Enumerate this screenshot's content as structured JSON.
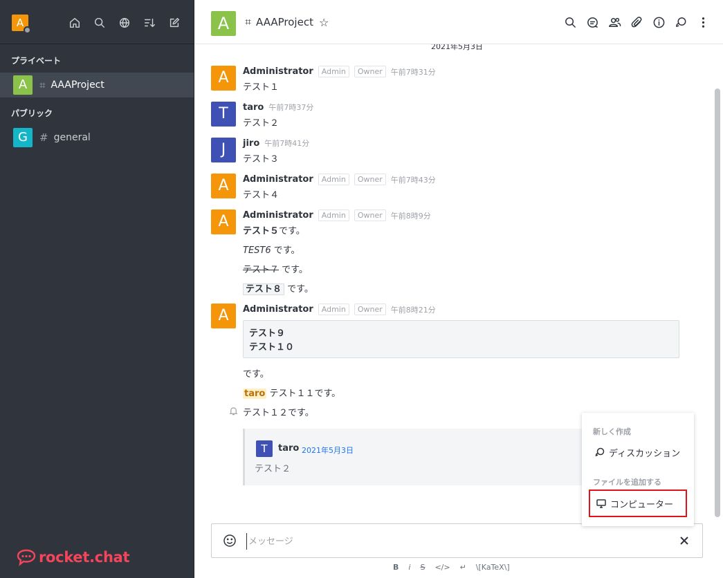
{
  "colors": {
    "sidebar_bg": "#2f343d",
    "accent_orange": "#f5960a",
    "avatar_green": "#8bc34a",
    "avatar_indigo": "#3f51b5",
    "avatar_teal": "#13b5c7",
    "brand_red": "#f5455c",
    "highlight_red": "#e0131b",
    "link_blue": "#1d74f5"
  },
  "sidebar": {
    "user_avatar_letter": "A",
    "top_icons": [
      "home-icon",
      "search-icon",
      "globe-icon",
      "sort-icon",
      "edit-icon"
    ],
    "private_label": "プライベート",
    "public_label": "パブリック",
    "private_rooms": [
      {
        "avatar": "A",
        "name": "AAAProject",
        "color": "#8bc34a",
        "active": true
      }
    ],
    "public_rooms": [
      {
        "avatar": "G",
        "name": "general",
        "color": "#13b5c7",
        "active": false
      }
    ],
    "logo_text": "rocket.chat"
  },
  "header": {
    "avatar_letter": "A",
    "room_name": "AAAProject",
    "star": "☆",
    "tools": [
      "search-icon",
      "threads-icon",
      "members-icon",
      "attachment-icon",
      "info-icon",
      "discussion-icon",
      "kebab-icon"
    ]
  },
  "date_divider": "2021年5月3日",
  "messages": [
    {
      "avatar": "A",
      "name": "Administrator",
      "tags": [
        "Admin",
        "Owner"
      ],
      "time": "午前7時31分",
      "text": "テスト１"
    },
    {
      "avatar": "T",
      "name": "taro",
      "tags": [],
      "time": "午前7時37分",
      "text": "テスト２"
    },
    {
      "avatar": "J",
      "name": "jiro",
      "tags": [],
      "time": "午前7時41分",
      "text": "テスト３"
    },
    {
      "avatar": "A",
      "name": "Administrator",
      "tags": [
        "Admin",
        "Owner"
      ],
      "time": "午前7時43分",
      "text": "テスト４"
    },
    {
      "avatar": "A",
      "name": "Administrator",
      "tags": [
        "Admin",
        "Owner"
      ],
      "time": "午前8時9分",
      "lines": {
        "bold": "テスト５",
        "bold_suffix": "です。",
        "italic": "TEST6",
        "italic_suffix": " です。",
        "strike": "テスト７",
        "strike_suffix": " です。",
        "code": "テスト８",
        "code_suffix": " です。"
      }
    },
    {
      "avatar": "A",
      "name": "Administrator",
      "tags": [
        "Admin",
        "Owner"
      ],
      "time": "午前8時21分",
      "codeblock": [
        "テスト９",
        "テスト１０"
      ],
      "after_code": "です。",
      "mention": "taro",
      "mention_suffix": " テスト１１です。",
      "last_line": "テスト１２です。",
      "quote": {
        "avatar": "T",
        "name": "taro",
        "date": "2021年5月3日",
        "text": "テスト２"
      }
    }
  ],
  "popup": {
    "create_header": "新しく作成",
    "discussion_label": "ディスカッション",
    "file_header": "ファイルを追加する",
    "computer_label": "コンピューター"
  },
  "composer": {
    "placeholder": "メッセージ",
    "formatting": [
      "B",
      "i",
      "S",
      "</>",
      "↵",
      "\\[KaTeX\\]"
    ]
  }
}
